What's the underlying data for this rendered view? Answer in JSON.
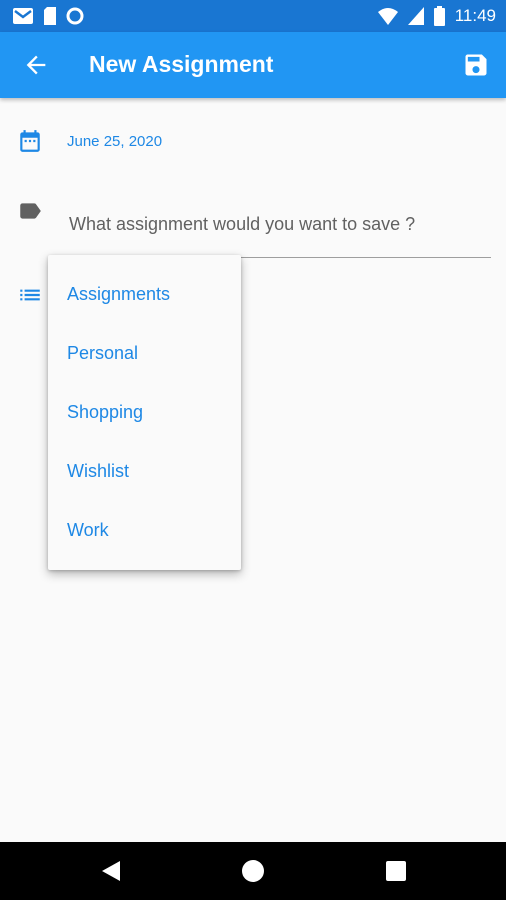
{
  "status_bar": {
    "time": "11:49",
    "left_icons": [
      "gmail-icon",
      "sim-card-icon",
      "circle-status-icon"
    ],
    "right_icons": [
      "wifi-icon",
      "cell-signal-icon",
      "battery-icon"
    ]
  },
  "app_bar": {
    "title": "New Assignment",
    "back_icon": "arrow-back-icon",
    "save_icon": "save-icon",
    "background": "#2196f3"
  },
  "form": {
    "date": "June 25, 2020",
    "assignment_placeholder": "What assignment would you want to save ?"
  },
  "category_menu": {
    "items": [
      "Assignments",
      "Personal",
      "Shopping",
      "Wishlist",
      "Work"
    ]
  },
  "colors": {
    "accent": "#1e88e5",
    "status_bar": "#1976d2"
  }
}
